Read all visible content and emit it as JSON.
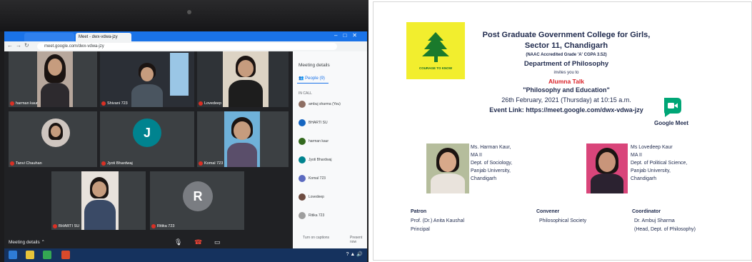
{
  "call": {
    "tab_label": "Meet - dwx-vdwa-jzy",
    "url": "meet.google.com/dwx-vdwa-jzy",
    "tiles": [
      {
        "name": "harman kaur"
      },
      {
        "name": "Shivani 723"
      },
      {
        "name": "Lovedeep"
      },
      {
        "name": "Tanvi Chauhan"
      },
      {
        "name": "Jyoti Bhardwaj",
        "initial": "J"
      },
      {
        "name": "Komal 723"
      },
      {
        "name": "BHARTI SU"
      },
      {
        "name": "Ritika 723",
        "initial": "R"
      }
    ],
    "meeting_details_btn": "Meeting details",
    "side_panel": {
      "title": "Meeting details",
      "people_tab": "People (9)",
      "count_label": "IN CALL",
      "participants": [
        "ambuj sharma (You)",
        "BHARTI SU",
        "harman kaur",
        "Jyoti Bhardwaj",
        "Komal 723",
        "Lovedeep",
        "Ritika 723"
      ]
    },
    "captions_label": "Turn on captions",
    "present_label": "Present now"
  },
  "poster": {
    "logo_motto": "COURAGE TO KNOW",
    "college_name": "Post Graduate Government College for Girls,",
    "college_sector": "Sector 11, Chandigarh",
    "accreditation": "(NAAC Accredited Grade 'A' CGPA 3.52)",
    "department": "Department of Philosophy",
    "invites": "invites you to",
    "event_kind": "Alumna Talk",
    "event_title": "\"Philosophy and Education\"",
    "event_date": "26th February, 2021 (Thursday) at 10:15 a.m.",
    "event_link": "Event Link: https://meet.google.com/dwx-vdwa-jzy",
    "meet_label": "Google Meet",
    "speaker1": [
      "Ms. Harman Kaur,",
      "MA II",
      "Dept. of Sociology,",
      "Panjab University,",
      "Chandigarh"
    ],
    "speaker2": [
      "Ms Lovedeep Kaur",
      "MA II",
      "Dept. of Political Science,",
      "Panjab University,",
      "Chandigarh"
    ],
    "patron": {
      "head": "Patron",
      "name": "Prof. (Dr.) Anita Kaushal",
      "role": "Principal"
    },
    "convener": {
      "head": "Convener",
      "name": "Philosophical Society"
    },
    "coordinator": {
      "head": "Coordinator",
      "name": "Dr. Ambuj Sharma",
      "role": "(Head, Dept. of Philosophy)"
    }
  },
  "colors": {
    "meet_dark": "#202124",
    "meet_accent": "#1a73e8",
    "poster_text": "#1f2a4d",
    "event_red": "#d91f26",
    "logo_yellow": "#f2ee2e"
  }
}
